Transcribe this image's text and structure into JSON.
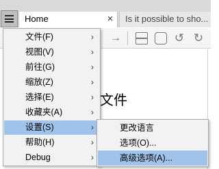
{
  "tabs": {
    "active_label": "Home",
    "inactive_label": "Is it possible to sho...",
    "close_glyph": "×"
  },
  "content": {
    "title_partial": "文件"
  },
  "menu": {
    "items": [
      {
        "label": "文件(F)",
        "arrow": "›"
      },
      {
        "label": "视图(V)",
        "arrow": "›"
      },
      {
        "label": "前往(G)",
        "arrow": "›"
      },
      {
        "label": "缩放(Z)",
        "arrow": "›"
      },
      {
        "label": "选择(E)",
        "arrow": "›"
      },
      {
        "label": "收藏夹(A)",
        "arrow": "›"
      },
      {
        "label": "设置(S)",
        "arrow": "›"
      },
      {
        "label": "帮助(H)",
        "arrow": "›"
      },
      {
        "label": "Debug",
        "arrow": "›"
      }
    ]
  },
  "submenu": {
    "items": [
      {
        "label": "更改语言"
      },
      {
        "label": "选项(O)..."
      },
      {
        "label": "高级选项(A)..."
      }
    ]
  },
  "colors": {
    "highlight": "#9fc3ea",
    "menu_bg": "#f2f2f2",
    "tabbar_bg": "#d9d9d9"
  }
}
